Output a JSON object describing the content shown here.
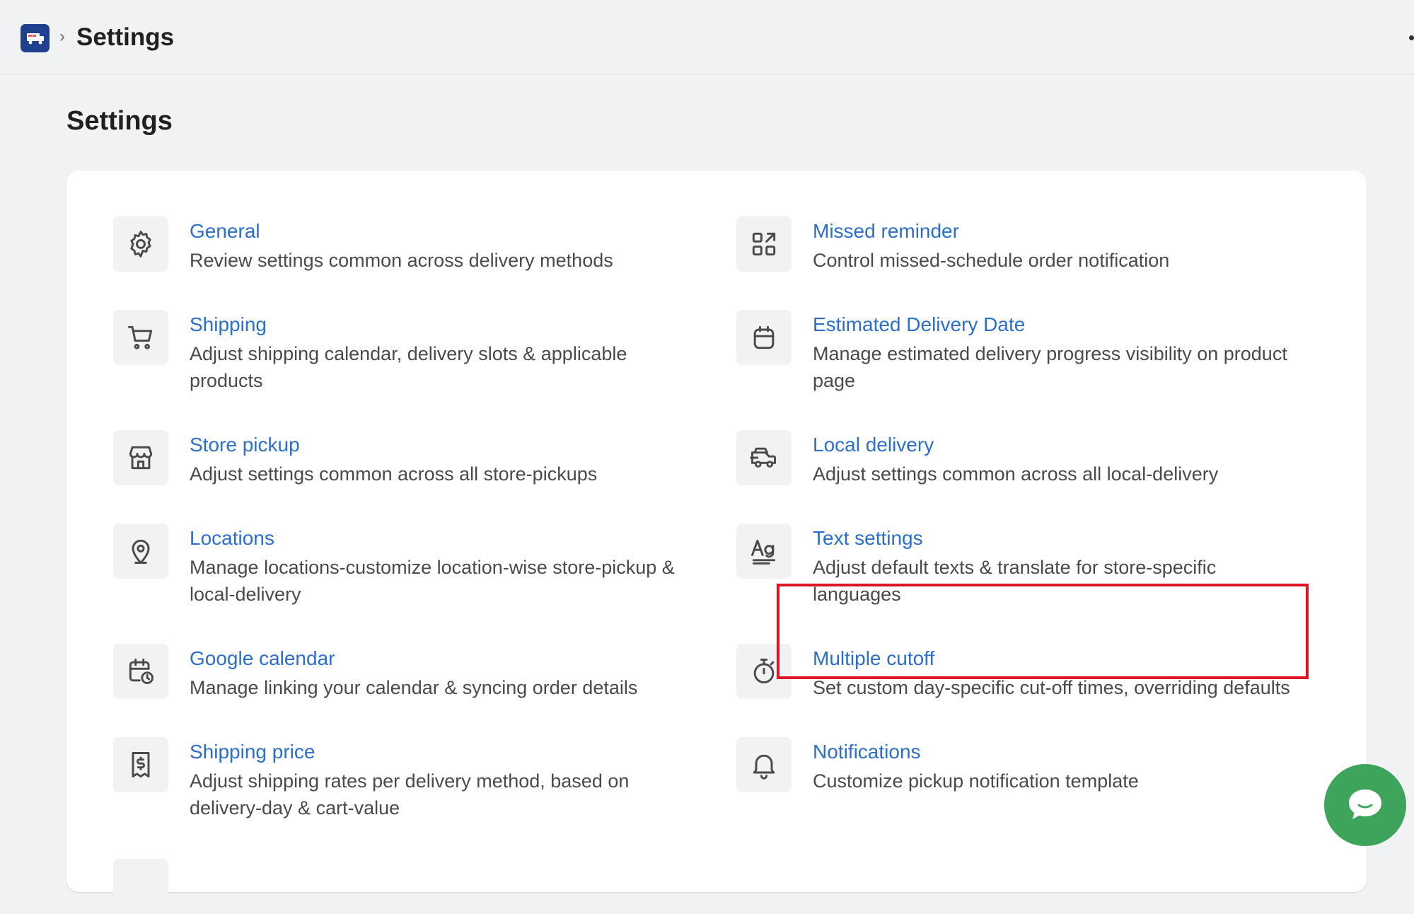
{
  "topbar": {
    "breadcrumb_separator": "›",
    "title": "Settings"
  },
  "page": {
    "title": "Settings"
  },
  "settings": {
    "general": {
      "title": "General",
      "description": "Review settings common across delivery methods",
      "icon": "gear-icon"
    },
    "missed_reminder": {
      "title": "Missed reminder",
      "description": "Control missed-schedule order notification",
      "icon": "apps-icon"
    },
    "shipping": {
      "title": "Shipping",
      "description": "Adjust shipping calendar, delivery slots & applicable products",
      "icon": "cart-icon"
    },
    "estimated_delivery": {
      "title": "Estimated Delivery Date",
      "description": "Manage estimated delivery progress visibility on product page",
      "icon": "calendar-icon"
    },
    "store_pickup": {
      "title": "Store pickup",
      "description": "Adjust settings common across all store-pickups",
      "icon": "store-icon"
    },
    "local_delivery": {
      "title": "Local delivery",
      "description": "Adjust settings common across all local-delivery",
      "icon": "delivery-icon"
    },
    "locations": {
      "title": "Locations",
      "description": "Manage locations-customize location-wise store-pickup & local-delivery",
      "icon": "location-pin-icon"
    },
    "text_settings": {
      "title": "Text settings",
      "description": "Adjust default texts & translate for store-specific languages",
      "icon": "text-icon"
    },
    "google_calendar": {
      "title": "Google calendar",
      "description": "Manage linking your calendar & syncing order details",
      "icon": "calendar-clock-icon"
    },
    "multiple_cutoff": {
      "title": "Multiple cutoff",
      "description": "Set custom day-specific cut-off times, overriding defaults",
      "icon": "stopwatch-icon"
    },
    "shipping_price": {
      "title": "Shipping price",
      "description": "Adjust shipping rates per delivery method, based on delivery-day & cart-value",
      "icon": "receipt-dollar-icon"
    },
    "notifications": {
      "title": "Notifications",
      "description": "Customize pickup notification template",
      "icon": "bell-icon"
    }
  },
  "colors": {
    "link": "#2c6ecb",
    "highlight": "#e01424",
    "chat": "#3fa45b",
    "logo": "#1f3f8f"
  }
}
